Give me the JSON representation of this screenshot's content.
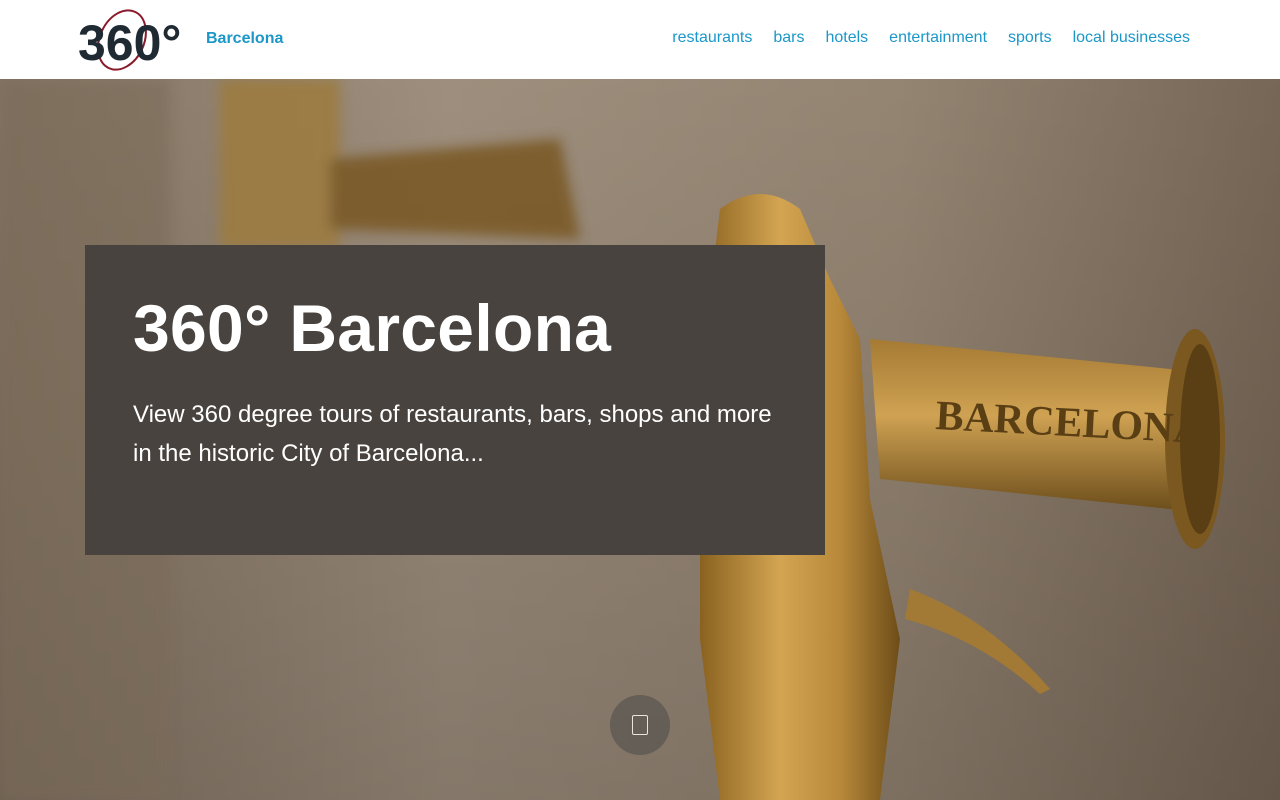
{
  "header": {
    "logo_text": "360°",
    "brand": "Barcelona",
    "nav": [
      "restaurants",
      "bars",
      "hotels",
      "entertainment",
      "sports",
      "local businesses"
    ]
  },
  "hero": {
    "title": "360° Barcelona",
    "description": "View 360 degree tours of restaurants, bars, shops and more in the historic City of Barcelona...",
    "faucet_engraving": "BARCELONA"
  },
  "scroll_button": {
    "icon": "scroll-down-icon"
  },
  "colors": {
    "accent": "#1b97c9",
    "panel": "#48433f",
    "brass": "#b8893a",
    "wall": "#9a8a78"
  }
}
